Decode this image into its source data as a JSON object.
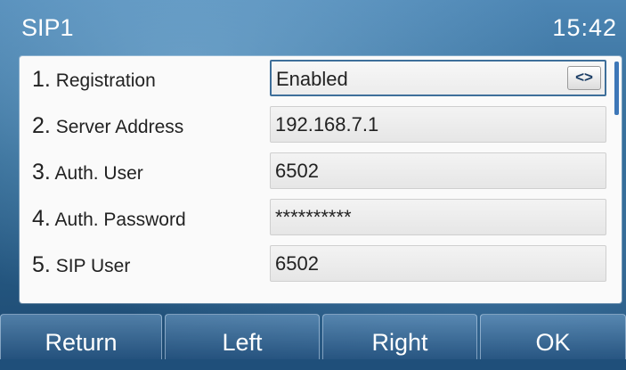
{
  "header": {
    "title": "SIP1",
    "time": "15:42"
  },
  "rows": [
    {
      "number": "1.",
      "label": "Registration",
      "value": "Enabled",
      "toggle": "<>"
    },
    {
      "number": "2.",
      "label": "Server Address",
      "value": "192.168.7.1"
    },
    {
      "number": "3.",
      "label": "Auth. User",
      "value": "6502"
    },
    {
      "number": "4.",
      "label": "Auth. Password",
      "value": "**********"
    },
    {
      "number": "5.",
      "label": "SIP User",
      "value": "6502"
    }
  ],
  "softkeys": [
    "Return",
    "Left",
    "Right",
    "OK"
  ],
  "colors": {
    "accent": "#3e6f9a",
    "background": "#2d6590"
  }
}
